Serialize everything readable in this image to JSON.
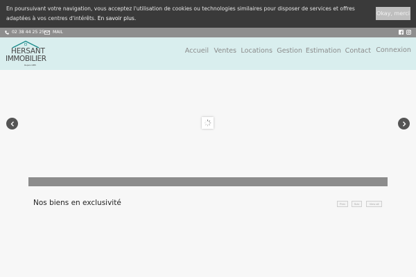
{
  "cookie": {
    "message": "En poursuivant votre navigation, vous acceptez l'utilisation de cookies ou technologies similaires pour disposer de services et offres adaptées à vos centres d'intérêts.",
    "more_link": "En savoir plus.",
    "accept_label": "Okay, merci"
  },
  "topbar": {
    "phone": "02 38 44 25 25",
    "mail": "MAIL"
  },
  "logo": {
    "line1": "HERSANT",
    "line2": "IMMOBILIER",
    "since": "Depuis 1955"
  },
  "nav": {
    "items": [
      "Accueil",
      "Ventes",
      "Locations",
      "Gestion",
      "Estimation",
      "Contact",
      "Connexion"
    ]
  },
  "section": {
    "title": "Nos biens en exclusivité",
    "prev": "Prev",
    "next": "Suiv",
    "view_all": "View all"
  },
  "colors": {
    "cookie_bg": "#3a3a3a",
    "topbar_bg": "#8e8e8e",
    "header_bg": "#d9eeee",
    "accent": "#1a8a8a"
  }
}
